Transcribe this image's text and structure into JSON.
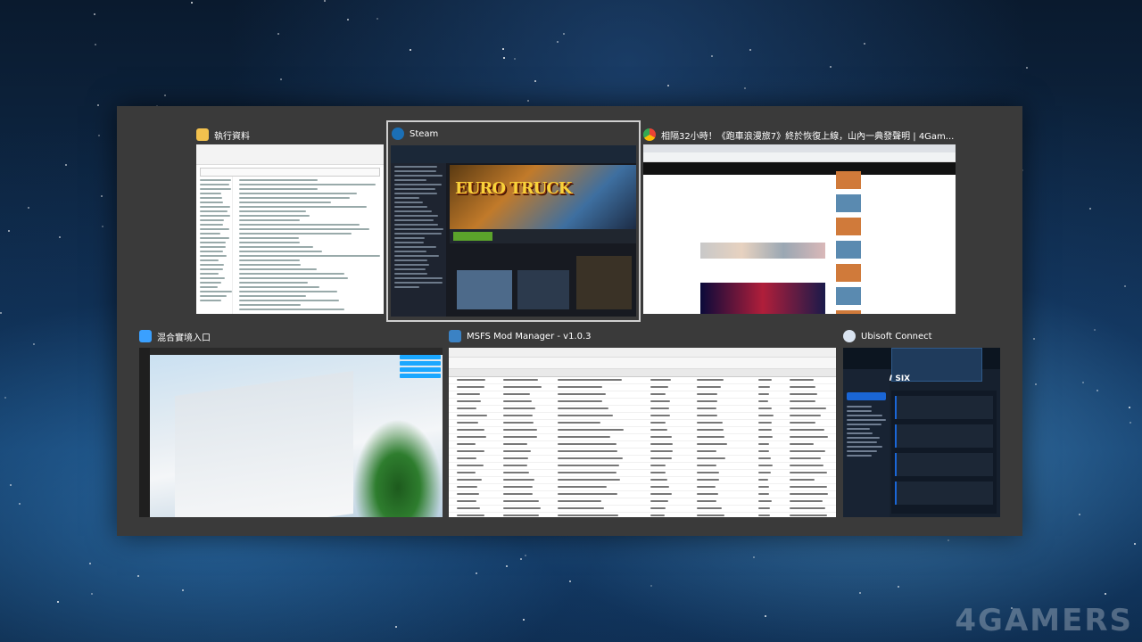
{
  "windows": {
    "explorer": {
      "title": "執行資料",
      "icon": "folder-icon",
      "icon_color": "#f2c14e"
    },
    "steam": {
      "title": "Steam",
      "icon": "steam-icon",
      "icon_color": "#1b6fb5",
      "logo_text": "EURO TRUCK"
    },
    "browser": {
      "title": "相隔32小時！《跑車浪漫旅7》終於恢復上線，山內一典發聲明 | 4Gam...",
      "icon": "chrome-icon",
      "icon_color": "#4285f4"
    },
    "mixed_reality": {
      "title": "混合實境入口",
      "icon": "mixed-reality-icon",
      "icon_color": "#3aa0ff"
    },
    "msfs": {
      "title": "MSFS Mod Manager - v1.0.3",
      "icon": "mod-manager-icon",
      "icon_color": "#3b82c4"
    },
    "ubisoft": {
      "title": "Ubisoft Connect",
      "icon": "ubisoft-icon",
      "icon_color": "#d9e3f0",
      "game_logo": "RAINBOW SIX"
    }
  },
  "watermark": "4GAMERS"
}
